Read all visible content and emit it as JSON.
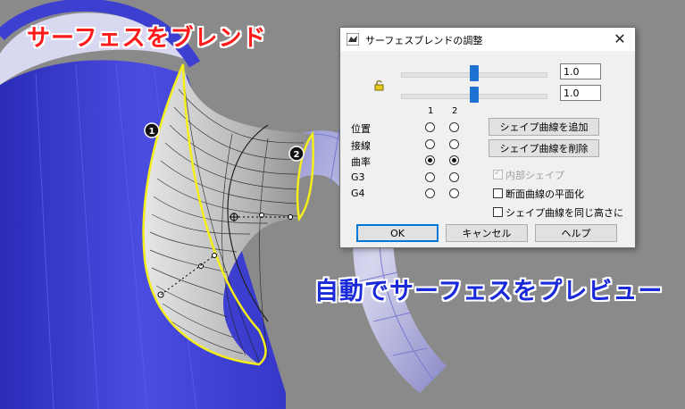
{
  "callouts": {
    "top": "サーフェスをブレンド",
    "bottom": "自動でサーフェスをプレビュー"
  },
  "markers": {
    "one": "1",
    "two": "2"
  },
  "dialog": {
    "title": "サーフェスブレンドの調整",
    "close_glyph": "✕",
    "sliders": [
      {
        "value": 0.5,
        "text": "1.0"
      },
      {
        "value": 0.5,
        "text": "1.0"
      }
    ],
    "column_headers": [
      "1",
      "2"
    ],
    "rows": [
      {
        "label": "位置",
        "col1": false,
        "col2": false
      },
      {
        "label": "接線",
        "col1": false,
        "col2": false
      },
      {
        "label": "曲率",
        "col1": true,
        "col2": true
      },
      {
        "label": "G3",
        "col1": false,
        "col2": false
      },
      {
        "label": "G4",
        "col1": false,
        "col2": false
      }
    ],
    "add_shape_curve": "シェイプ曲線を追加",
    "remove_shape_curve": "シェイプ曲線を削除",
    "checkboxes": {
      "inner_shape": {
        "label": "内部シェイプ",
        "checked": true,
        "disabled": true
      },
      "planar_sections": {
        "label": "断面曲線の平面化",
        "checked": false
      },
      "same_height": {
        "label": "シェイプ曲線を同じ高さに",
        "checked": false
      }
    },
    "ok": "OK",
    "cancel": "キャンセル",
    "help": "ヘルプ"
  },
  "colors": {
    "viewport_bg": "#8a8a8a",
    "mug_blue": "#3d3fd0",
    "surface_gray": "#bdbdbd",
    "edge_yellow": "#f4ee1a",
    "accent_red": "#ff1a1a",
    "accent_blue": "#1a2ad8",
    "slider_thumb": "#1e73d2"
  }
}
